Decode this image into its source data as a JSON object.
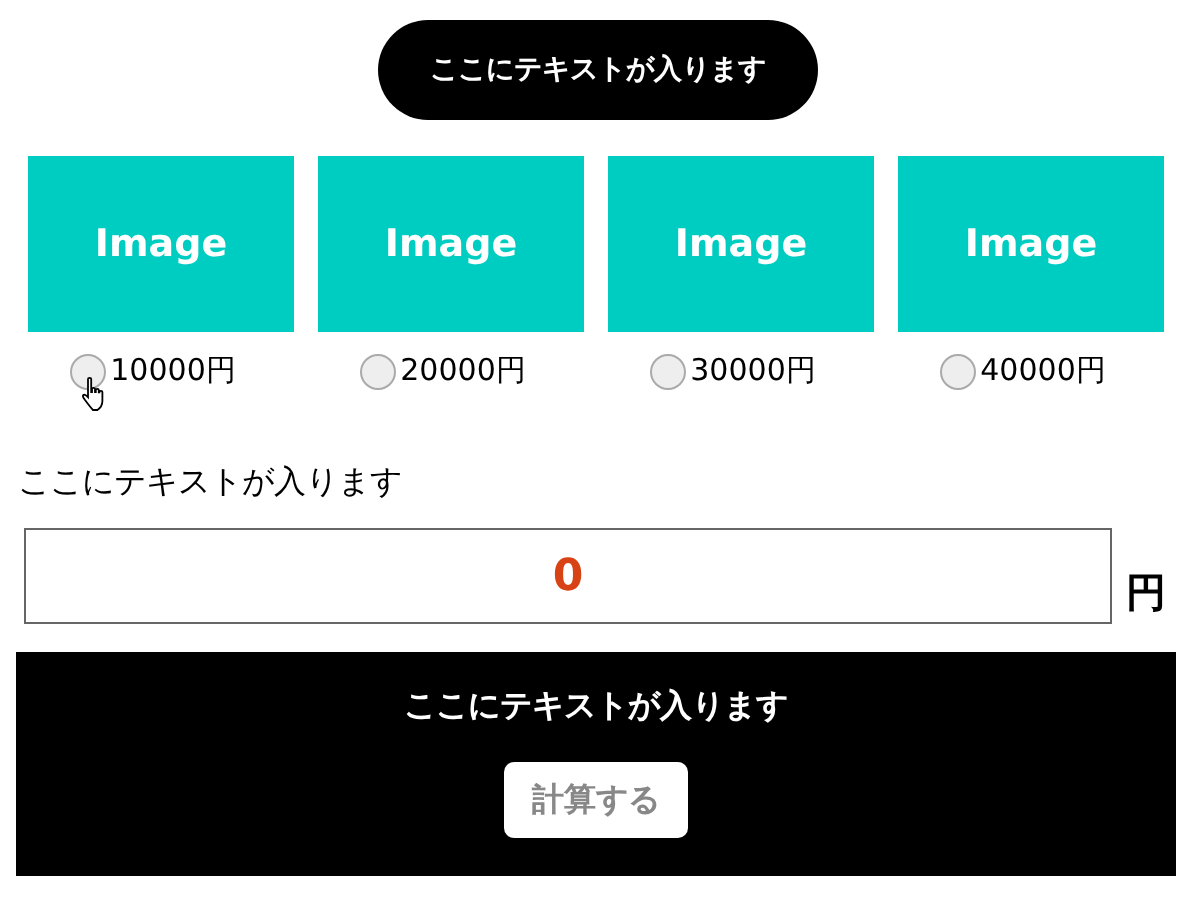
{
  "header_button": {
    "label": "ここにテキストが入ります"
  },
  "options": [
    {
      "image_label": "Image",
      "price": "10000円",
      "selected": false,
      "hovered": true
    },
    {
      "image_label": "Image",
      "price": "20000円",
      "selected": false,
      "hovered": false
    },
    {
      "image_label": "Image",
      "price": "30000円",
      "selected": false,
      "hovered": false
    },
    {
      "image_label": "Image",
      "price": "40000円",
      "selected": false,
      "hovered": false
    }
  ],
  "field_label": "ここにテキストが入ります",
  "result": {
    "value": "0",
    "unit": "円"
  },
  "panel": {
    "heading": "ここにテキストが入ります",
    "button": {
      "label": "計算する",
      "disabled": true
    }
  }
}
